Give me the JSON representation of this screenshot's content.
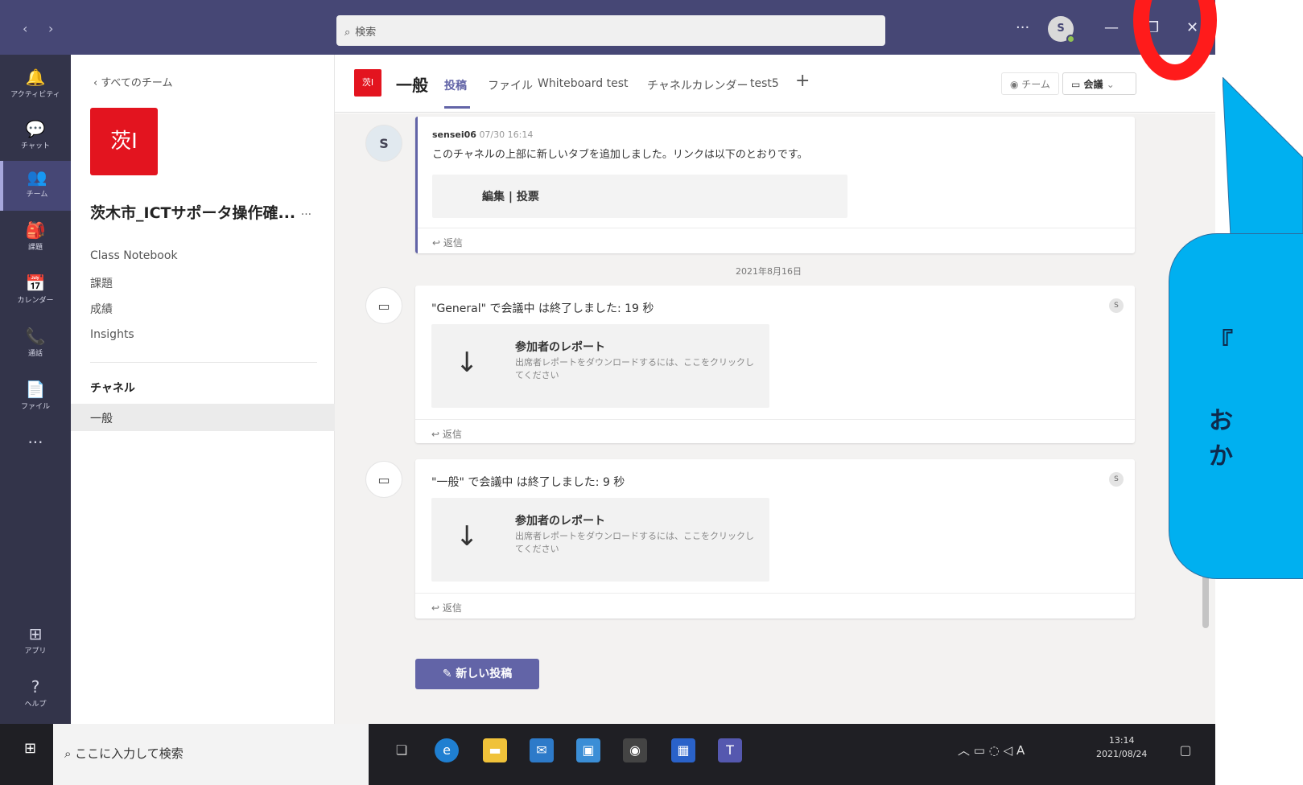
{
  "titlebar": {
    "back_arrow": "‹",
    "forward_arrow": "›",
    "search_icon": "search-icon",
    "search_placeholder": "検索",
    "more": "···",
    "avatar_initial": "S",
    "minimize": "—",
    "maximize": "❐",
    "close": "✕"
  },
  "rail": {
    "items": [
      {
        "label": "アクティビティ",
        "icon": "bell-icon",
        "glyph": "🔔"
      },
      {
        "label": "チャット",
        "icon": "chat-icon",
        "glyph": "💬"
      },
      {
        "label": "チーム",
        "icon": "teams-icon",
        "glyph": "👥"
      },
      {
        "label": "課題",
        "icon": "assignments-icon",
        "glyph": "🎒"
      },
      {
        "label": "カレンダー",
        "icon": "calendar-icon",
        "glyph": "📅"
      },
      {
        "label": "通話",
        "icon": "phone-icon",
        "glyph": "📞"
      },
      {
        "label": "ファイル",
        "icon": "file-icon",
        "glyph": "📄"
      },
      {
        "label": "",
        "icon": "more-icon",
        "glyph": "···"
      },
      {
        "label": "アプリ",
        "icon": "apps-icon",
        "glyph": "⊞"
      },
      {
        "label": "ヘルプ",
        "icon": "help-icon",
        "glyph": "?"
      }
    ]
  },
  "sidebar": {
    "back_label": "すべてのチーム",
    "team_logo_text": "茨I",
    "team_name": "茨木市_ICTサポータ操作確...",
    "team_more": "···",
    "links": [
      "Class Notebook",
      "課題",
      "成績",
      "Insights"
    ],
    "channels_heading": "チャネル",
    "channel": "一般"
  },
  "channel_header": {
    "icon_text": "茨I",
    "title": "一般",
    "tabs": [
      "投稿",
      "ファイル",
      "Whiteboard test",
      "チャネルカレンダー",
      "test5"
    ],
    "add_tab": "+",
    "team_button": "チーム",
    "meet_button": "会議"
  },
  "feed": {
    "post1": {
      "avatar": "S",
      "author": "sensei06",
      "time": "07/30 16:14",
      "body": "このチャネルの上部に新しいタブを追加しました。リンクは以下のとおりです。",
      "attachment": "編集 | 投票",
      "reply": "返信"
    },
    "date_divider": "2021年8月16日",
    "meeting1": {
      "title": "\"General\" で会議中 は終了しました: 19 秒",
      "report_title": "参加者のレポート",
      "report_sub": "出席者レポートをダウンロードするには、ここをクリックしてください",
      "reply": "返信",
      "mini_avatar": "S"
    },
    "meeting2": {
      "title": "\"一般\" で会議中 は終了しました: 9 秒",
      "report_title": "参加者のレポート",
      "report_sub": "出席者レポートをダウンロードするには、ここをクリックしてください",
      "reply": "返信",
      "mini_avatar": "S"
    },
    "new_post": "新しい投稿"
  },
  "taskbar": {
    "search_text": "ここに入力して検索",
    "time": "13:14",
    "date": "2021/08/24",
    "ime": "A"
  },
  "annotation": {
    "line1": "『",
    "line2": "お",
    "line3": "か"
  },
  "colors": {
    "titlebar": "#464775",
    "rail": "#33344a",
    "accent": "#6264a7",
    "team_red": "#e3141f",
    "callout": "#00b0f0",
    "circle": "#ff1b1b"
  }
}
